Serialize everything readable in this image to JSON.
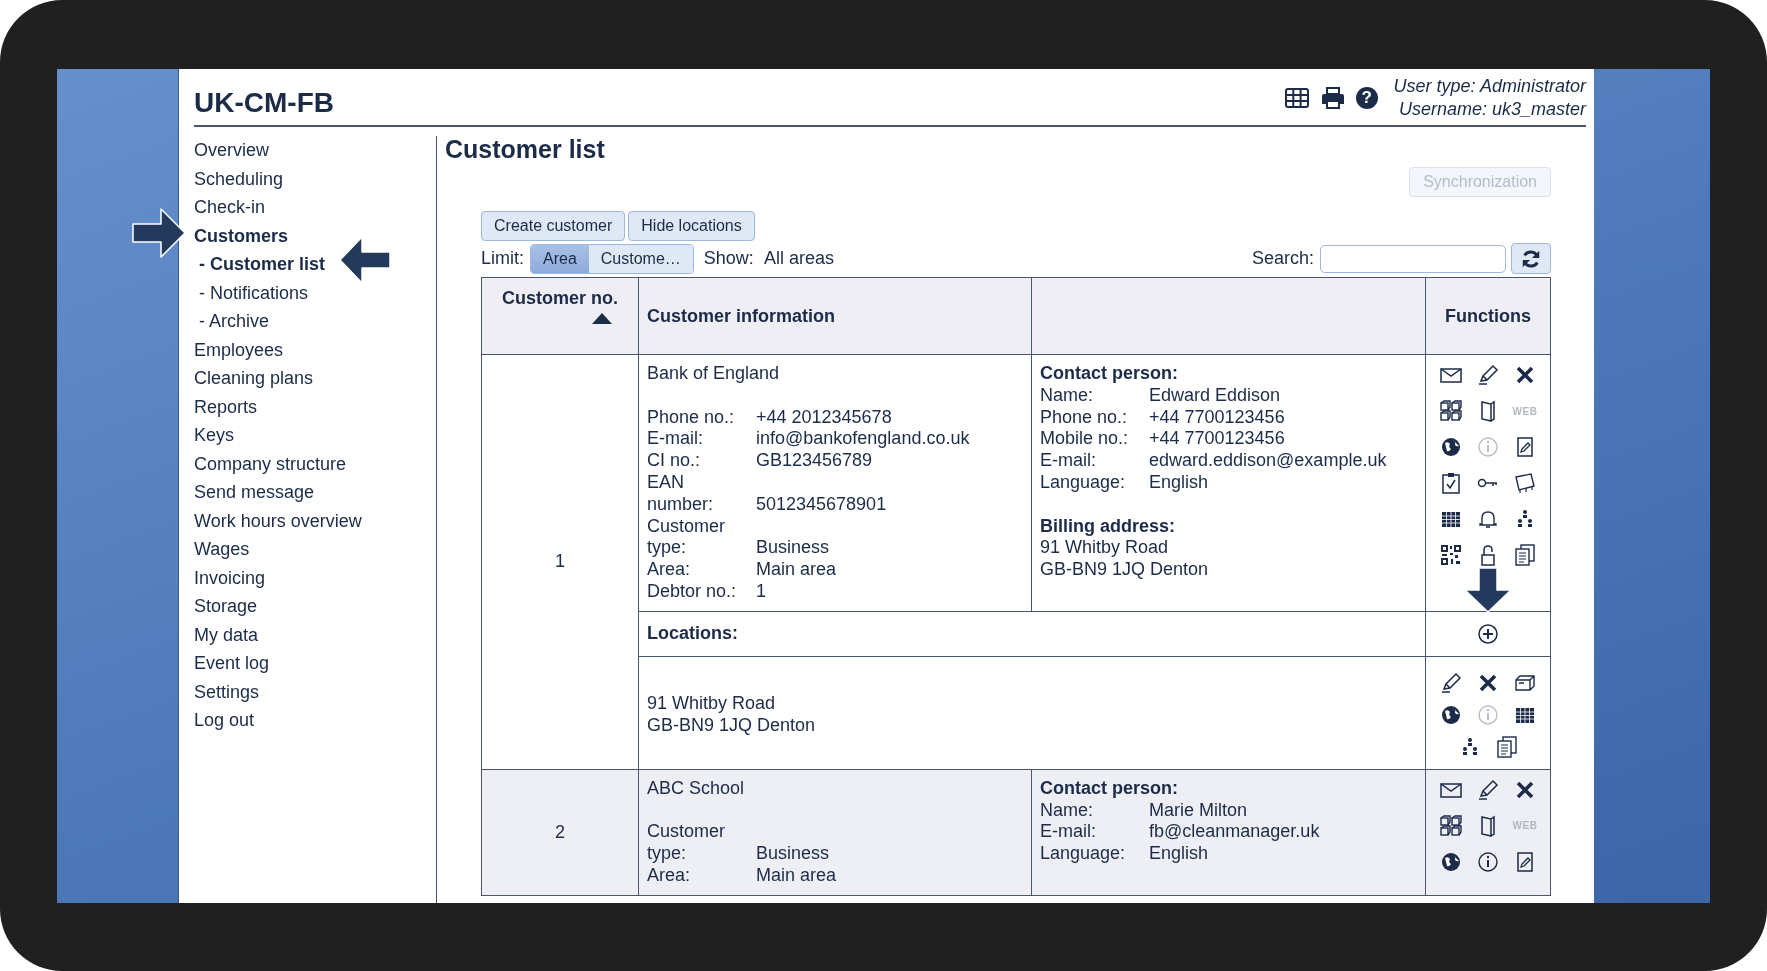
{
  "app": {
    "title": "UK-CM-FB",
    "toolbar_icons": [
      {
        "kind": "table"
      },
      {
        "kind": "print"
      },
      {
        "kind": "help",
        "glyph": "?"
      }
    ],
    "user_type": "User type: Administrator",
    "username": "Username: uk3_master"
  },
  "sidebar": {
    "items": [
      {
        "label": "Overview",
        "selected": false
      },
      {
        "label": "Scheduling",
        "selected": false
      },
      {
        "label": "Check-in",
        "selected": false
      },
      {
        "label": "Customers",
        "selected": true,
        "children": [
          {
            "label": "- Customer list",
            "selected": true
          },
          {
            "label": "- Notifications",
            "selected": false
          },
          {
            "label": "- Archive",
            "selected": false
          }
        ]
      },
      {
        "label": "Employees",
        "selected": false
      },
      {
        "label": "Cleaning plans",
        "selected": false
      },
      {
        "label": "Reports",
        "selected": false
      },
      {
        "label": "Keys",
        "selected": false
      },
      {
        "label": "Company structure",
        "selected": false
      },
      {
        "label": "Send message",
        "selected": false
      },
      {
        "label": "Work hours overview",
        "selected": false
      },
      {
        "label": "Wages",
        "selected": false
      },
      {
        "label": "Invoicing",
        "selected": false
      },
      {
        "label": "Storage",
        "selected": false
      },
      {
        "label": "My data",
        "selected": false
      },
      {
        "label": "Event log",
        "selected": false
      },
      {
        "label": "Settings",
        "selected": false
      },
      {
        "label": "Log out",
        "selected": false
      }
    ]
  },
  "page": {
    "title": "Customer list",
    "sync_button": {
      "label": "Synchronization",
      "disabled": true
    },
    "buttons": [
      "Create customer",
      "Hide locations"
    ],
    "limit": {
      "label": "Limit:",
      "options": [
        {
          "label": "Area",
          "selected": true
        },
        {
          "label": "Custome…",
          "selected": false
        }
      ]
    },
    "show": {
      "label": "Show:",
      "value": "All areas"
    },
    "search": {
      "label": "Search:"
    }
  },
  "table": {
    "columns": [
      {
        "label": "Customer no.",
        "sorted": true
      },
      {
        "label": "Customer information",
        "sorted": false
      },
      {
        "label": "Functions",
        "sorted": false
      }
    ],
    "rows": [
      {
        "number": "1",
        "name": "Bank of England",
        "details": [
          {
            "label": "Phone no.:",
            "value": "+44 2012345678"
          },
          {
            "label": "E-mail:",
            "value": "info@bankofengland.co.uk"
          },
          {
            "label": "CI no.:",
            "value": "GB123456789"
          },
          {
            "label": "EAN number:",
            "value": "5012345678901"
          },
          {
            "label": "Customer type:",
            "value": "Business"
          },
          {
            "label": "Area:",
            "value": "Main area"
          },
          {
            "label": "Debtor no.:",
            "value": "1"
          }
        ],
        "contact": {
          "heading": "Contact person:",
          "fields": [
            {
              "label": "Name:",
              "value": "Edward Eddison"
            },
            {
              "label": "Phone no.:",
              "value": "+44 7700123456"
            },
            {
              "label": "Mobile no.:",
              "value": "+44 7700123456"
            },
            {
              "label": "E-mail:",
              "value": "edward.eddison@example.uk"
            },
            {
              "label": "Language:",
              "value": "English"
            }
          ]
        },
        "billing": {
          "heading": "Billing address:",
          "lines": [
            "91 Whitby Road",
            "GB-BN9 1JQ Denton"
          ]
        },
        "functions": [
          {
            "kind": "envelope",
            "disabled": false
          },
          {
            "kind": "pencil",
            "disabled": false
          },
          {
            "kind": "cross",
            "disabled": false
          },
          {
            "kind": "boxes",
            "disabled": false
          },
          {
            "kind": "book",
            "disabled": false
          },
          {
            "kind": "web",
            "label": "WEB",
            "disabled": true
          },
          {
            "kind": "globe",
            "disabled": false
          },
          {
            "kind": "info",
            "disabled": true
          },
          {
            "kind": "edit-document",
            "disabled": false
          },
          {
            "kind": "clipboard",
            "disabled": false
          },
          {
            "kind": "key",
            "disabled": false
          },
          {
            "kind": "map",
            "disabled": false
          },
          {
            "kind": "calendar",
            "disabled": false
          },
          {
            "kind": "bell",
            "disabled": false
          },
          {
            "kind": "people",
            "disabled": false
          },
          {
            "kind": "qr",
            "disabled": false
          },
          {
            "kind": "padlock",
            "disabled": false
          },
          {
            "kind": "documents",
            "disabled": false
          }
        ],
        "locations": {
          "heading": "Locations:",
          "items": [
            {
              "lines": [
                "91 Whitby Road",
                "GB-BN9 1JQ Denton"
              ],
              "functions": [
                {
                  "kind": "pencil",
                  "disabled": false
                },
                {
                  "kind": "cross",
                  "disabled": false
                },
                {
                  "kind": "box",
                  "disabled": false
                },
                {
                  "kind": "globe",
                  "disabled": false
                },
                {
                  "kind": "info",
                  "disabled": true
                },
                {
                  "kind": "calendar",
                  "disabled": false
                },
                {
                  "kind": "people",
                  "disabled": false
                },
                {
                  "kind": "documents",
                  "disabled": false
                }
              ]
            }
          ]
        }
      },
      {
        "number": "2",
        "name": "ABC School",
        "details": [
          {
            "label": "Customer type:",
            "value": "Business"
          },
          {
            "label": "Area:",
            "value": "Main area"
          }
        ],
        "contact": {
          "heading": "Contact person:",
          "fields": [
            {
              "label": "Name:",
              "value": "Marie Milton"
            },
            {
              "label": "E-mail:",
              "value": "fb@cleanmanager.uk"
            },
            {
              "label": "Language:",
              "value": "English"
            }
          ]
        },
        "functions": [
          {
            "kind": "envelope",
            "disabled": false
          },
          {
            "kind": "pencil",
            "disabled": false
          },
          {
            "kind": "cross",
            "disabled": false
          },
          {
            "kind": "boxes",
            "disabled": false
          },
          {
            "kind": "book",
            "disabled": false
          },
          {
            "kind": "web",
            "label": "WEB",
            "disabled": true
          },
          {
            "kind": "globe",
            "disabled": false
          },
          {
            "kind": "info",
            "disabled": false
          },
          {
            "kind": "edit-document",
            "disabled": false
          }
        ]
      }
    ]
  }
}
